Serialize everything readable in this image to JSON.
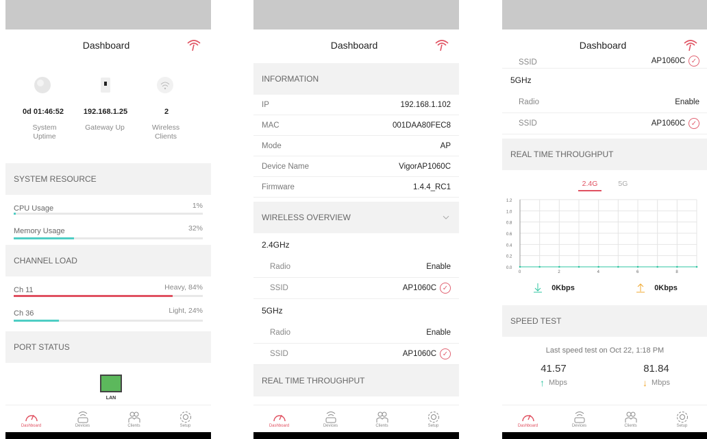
{
  "header": {
    "title": "Dashboard",
    "alert_icon": "wifi-alert-icon",
    "accent": "#e05060"
  },
  "tabs": [
    {
      "label": "Dashboard",
      "icon": "speedometer-icon"
    },
    {
      "label": "Devices",
      "icon": "router-icon"
    },
    {
      "label": "Clients",
      "icon": "clients-icon"
    },
    {
      "label": "Setup",
      "icon": "gear-icon"
    }
  ],
  "overview": {
    "uptime_value": "0d 01:46:52",
    "uptime_label": "System Uptime",
    "gateway_value": "192.168.1.25",
    "gateway_label": "Gateway Up",
    "clients_value": "2",
    "clients_label": "Wireless Clients"
  },
  "system_resource": {
    "title": "SYSTEM RESOURCE",
    "cpu_label": "CPU Usage",
    "cpu_value": "1%",
    "cpu_fraction": 0.01,
    "mem_label": "Memory Usage",
    "mem_value": "32%",
    "mem_fraction": 0.32
  },
  "channel_load": {
    "title": "CHANNEL LOAD",
    "ch11_label": "Ch 11",
    "ch11_value": "Heavy, 84%",
    "ch11_fraction": 0.84,
    "ch36_label": "Ch 36",
    "ch36_value": "Light, 24%",
    "ch36_fraction": 0.24
  },
  "port_status": {
    "title": "PORT STATUS",
    "lan_label": "LAN"
  },
  "information": {
    "title": "INFORMATION",
    "rows": [
      {
        "label": "IP",
        "value": "192.168.1.102"
      },
      {
        "label": "MAC",
        "value": "001DAA80FEC8"
      },
      {
        "label": "Mode",
        "value": "AP"
      },
      {
        "label": "Device Name",
        "value": "VigorAP1060C"
      },
      {
        "label": "Firmware",
        "value": "1.4.4_RC1"
      }
    ]
  },
  "wireless": {
    "title": "WIRELESS OVERVIEW",
    "band24": "2.4GHz",
    "band5": "5GHz",
    "radio_label": "Radio",
    "radio_value": "Enable",
    "ssid_label": "SSID",
    "ssid_value": "AP1060C",
    "ssid_cut_label": "SSID",
    "ssid_cut_value": "AP1060C"
  },
  "throughput": {
    "title": "REAL TIME THROUGHPUT",
    "tab_24": "2.4G",
    "tab_5": "5G",
    "down_value": "0Kbps",
    "up_value": "0Kbps",
    "y_ticks": [
      "1.2",
      "1.0",
      "0.8",
      "0.6",
      "0.4",
      "0.2",
      "0.0"
    ],
    "x_ticks": [
      "0",
      "2",
      "4",
      "6",
      "8"
    ]
  },
  "chart_data": {
    "type": "line",
    "x": [
      0,
      1,
      2,
      3,
      4,
      5,
      6,
      7,
      8,
      9
    ],
    "series": [
      {
        "values": [
          0,
          0,
          0,
          0,
          0,
          0,
          0,
          0,
          0,
          0
        ]
      }
    ],
    "ylim": [
      0,
      1.2
    ],
    "xlim": [
      0,
      9
    ]
  },
  "speed_test": {
    "title": "SPEED TEST",
    "note": "Last speed test on Oct 22, 1:18 PM",
    "down_value": "41.57",
    "up_value": "81.84",
    "unit": "Mbps"
  }
}
